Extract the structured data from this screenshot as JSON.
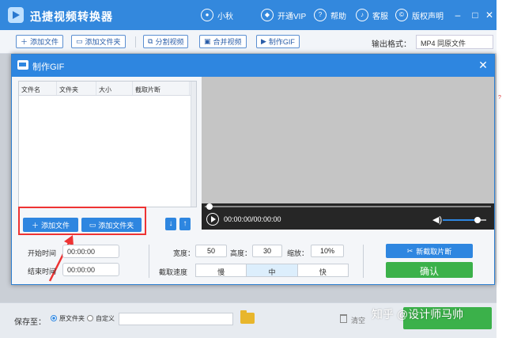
{
  "app": {
    "title": "迅捷视频转换器"
  },
  "titlebar": {
    "user": "小秋",
    "vip": "开通VIP",
    "help": "帮助",
    "service": "客服",
    "copyright": "版权声明",
    "icons": [
      "user-icon",
      "vip-icon",
      "help-icon",
      "service-icon",
      "copyright-icon"
    ]
  },
  "toolbar": {
    "add_file": "添加文件",
    "add_folder": "添加文件夹",
    "split_video": "分割视频",
    "merge_video": "合并视频",
    "make_gif": "制作GIF",
    "output_format_label": "输出格式：",
    "output_format_value": "MP4  同原文件"
  },
  "dialog": {
    "title": "制作GIF",
    "table_headers": [
      "文件名",
      "文件夹",
      "大小",
      "截取片断"
    ],
    "add_file": "添加文件",
    "add_folder": "添加文件夹",
    "timecode": "00:00:00/00:00:00",
    "volume": 0.8,
    "start_label": "开始时间",
    "start_value": "00:00:00",
    "end_label": "结束时间",
    "end_value": "00:00:00",
    "width_label": "宽度：",
    "width_value": "50",
    "height_label": "高度：",
    "height_value": "30",
    "scale_label": "缩放：",
    "scale_value": "10%",
    "speed_label": "截取速度",
    "speed_options": [
      "慢",
      "中",
      "快"
    ],
    "speed_selected": "中",
    "new_clip": "新截取片断",
    "confirm": "确认"
  },
  "bottombar": {
    "save_to": "保存至：",
    "opt_source": "原文件夹",
    "opt_custom": "自定义",
    "clear": "清空"
  },
  "watermark": "知乎 @设计师马帅",
  "colors": {
    "titlebar": "#3388dd",
    "accent": "#2e86e0",
    "confirm": "#3bb14a",
    "highlight": "#e33333"
  }
}
